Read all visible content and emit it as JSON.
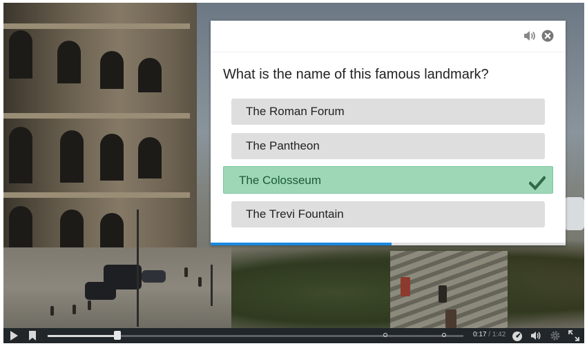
{
  "quiz": {
    "question": "What is the name of this famous landmark?",
    "answers": [
      {
        "label": "The Roman Forum",
        "state": "default"
      },
      {
        "label": "The Pantheon",
        "state": "default"
      },
      {
        "label": "The Colosseum",
        "state": "correct"
      },
      {
        "label": "The Trevi Fountain",
        "state": "default"
      }
    ],
    "progress": 0.51,
    "icons": {
      "audio": "speaker-icon",
      "close": "close-circle-icon",
      "correct": "checkmark-icon"
    }
  },
  "player": {
    "current_time": "0:17",
    "separator": "/",
    "duration": "1:42",
    "played_fraction": 0.167,
    "icons": [
      "play-icon",
      "bookmark-icon",
      "speed-dial-icon",
      "volume-icon",
      "settings-icon",
      "fullscreen-icon"
    ]
  },
  "colors": {
    "correct_bg": "#9dd7b6",
    "correct_check": "#2f6b45",
    "answer_bg": "#dedede",
    "progress": "#1a87e0"
  }
}
